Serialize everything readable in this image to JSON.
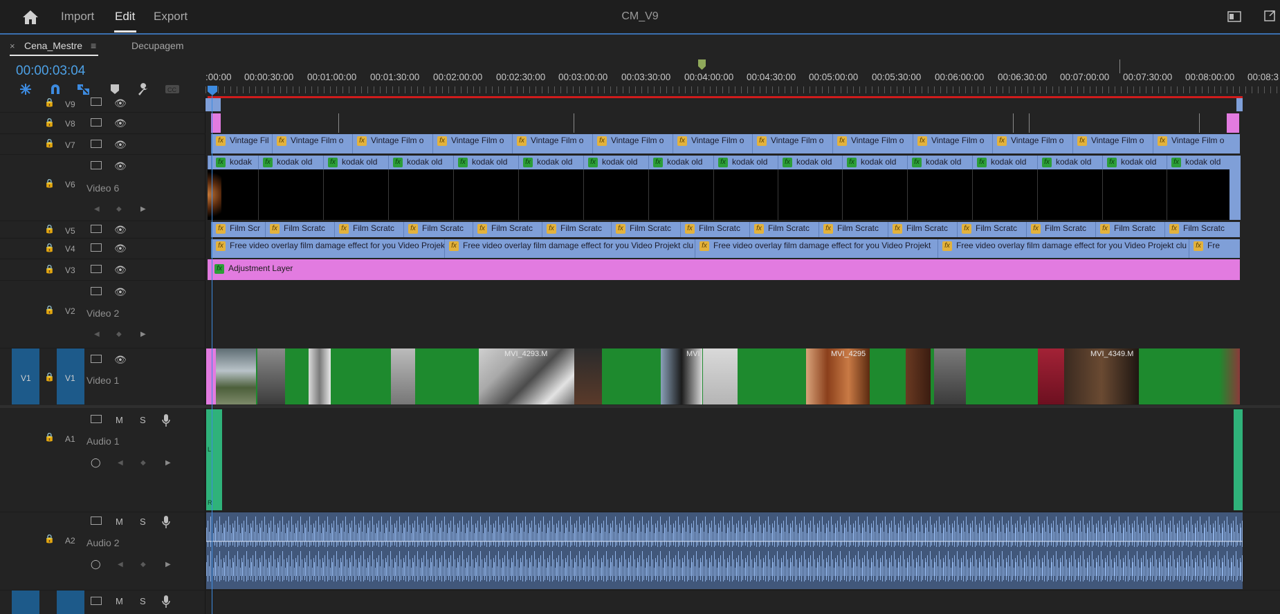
{
  "header": {
    "menu": [
      "Import",
      "Edit",
      "Export"
    ],
    "active_menu": "Edit",
    "title": "CM_V9"
  },
  "panel": {
    "tabs": [
      {
        "label": "Cena_Mestre",
        "close": "×",
        "menu": "≡"
      },
      {
        "label": "Decupagem"
      }
    ],
    "timecode": "00:00:03:04"
  },
  "ruler": {
    "labels": [
      ":00:00",
      "00:00:30:00",
      "00:01:00:00",
      "00:01:30:00",
      "00:02:00:00",
      "00:02:30:00",
      "00:03:00:00",
      "00:03:30:00",
      "00:04:00:00",
      "00:04:30:00",
      "00:05:00:00",
      "00:05:30:00",
      "00:06:00:00",
      "00:06:30:00",
      "00:07:00:00",
      "00:07:30:00",
      "00:08:00:00",
      "00:08:3"
    ]
  },
  "tracks": {
    "video": [
      {
        "id": "V9"
      },
      {
        "id": "V8"
      },
      {
        "id": "V7"
      },
      {
        "id": "V6",
        "name": "Video 6"
      },
      {
        "id": "V5"
      },
      {
        "id": "V4"
      },
      {
        "id": "V3"
      },
      {
        "id": "V2",
        "name": "Video 2"
      },
      {
        "id": "V1",
        "name": "Video 1",
        "source": "V1"
      }
    ],
    "audio": [
      {
        "id": "A1",
        "name": "Audio 1",
        "m": "M",
        "s": "S"
      },
      {
        "id": "A2",
        "name": "Audio 2",
        "m": "M",
        "s": "S"
      }
    ]
  },
  "clips": {
    "v7": [
      "Vintage Fil",
      "Vintage Film o",
      "Vintage Film o",
      "Vintage Film o",
      "Vintage Film o",
      "Vintage Film o",
      "Vintage Film o",
      "Vintage Film o",
      "Vintage Film o",
      "Vintage Film o",
      "Vintage Film o",
      "Vintage Film o",
      "Vintage Film o"
    ],
    "v6": [
      "kodak",
      "kodak old",
      "kodak old",
      "kodak old",
      "kodak old",
      "kodak old",
      "kodak old",
      "kodak old",
      "kodak old",
      "kodak old",
      "kodak old",
      "kodak old",
      "kodak old",
      "kodak old",
      "kodak old",
      "kodak old"
    ],
    "v5": [
      "Film Scr",
      "Film Scratc",
      "Film Scratc",
      "Film Scratc",
      "Film Scratc",
      "Film Scratc",
      "Film Scratc",
      "Film Scratc",
      "Film Scratc",
      "Film Scratc",
      "Film Scratc",
      "Film Scratc",
      "Film Scratc",
      "Film Scratc",
      "Film Scratc"
    ],
    "v4": [
      "Free video overlay film damage effect for you Video Projekt",
      "Free video overlay film damage effect for you Video Projekt clu",
      "Free video overlay film damage effect for you Video Projekt",
      "Free video overlay film damage effect for you Video Projekt clu",
      "Fre"
    ],
    "v3": "Adjustment Layer",
    "v1_labels": [
      "MVI_4293.M",
      "MVI",
      "MVI_4295",
      "MVI_4349.M"
    ],
    "fx_label": "fx"
  },
  "audio_channels": {
    "left": "L",
    "right": "R"
  },
  "colors": {
    "accent": "#3d8be0",
    "timecode": "#4da1e6",
    "clip_blue": "#7f9fd8",
    "adjustment_pink": "#e27be0",
    "clip_green": "#1e8a2e",
    "audio_green": "#2fb27a",
    "wave_blue": "#41577a",
    "work_area_red": "#d01b1b"
  },
  "icons": [
    "home-icon",
    "panel-icon",
    "maximize-icon",
    "snap-icon",
    "magnet-icon",
    "linked-select-icon",
    "marker-icon",
    "wrench-icon",
    "captions-icon",
    "lock-icon",
    "film-toggle-icon",
    "eye-icon",
    "mic-icon",
    "keyframe-icon"
  ]
}
